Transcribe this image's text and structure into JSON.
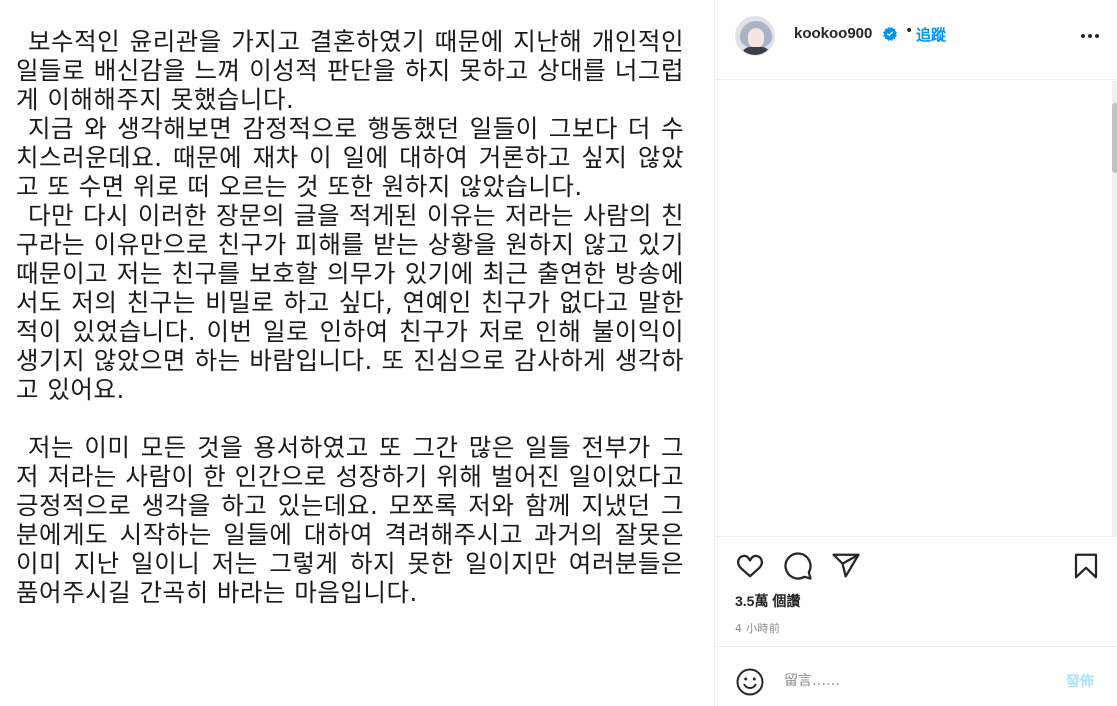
{
  "post": {
    "paragraphs": [
      "보수적인 윤리관을 가지고 결혼하였기 때문에 지난해 개인적인 일들로 배신감을 느껴 이성적 판단을 하지 못하고 상대를 너그럽게 이해해주지 못했습니다.",
      "지금 와 생각해보면 감정적으로 행동했던 일들이 그보다 더 수치스러운데요. 때문에 재차 이 일에 대하여 거론하고 싶지 않았고 또 수면 위로 떠 오르는 것 또한 원하지 않았습니다.",
      "다만 다시 이러한 장문의 글을 적게된 이유는 저라는 사람의 친구라는 이유만으로 친구가 피해를 받는 상황을 원하지 않고 있기 때문이고 저는 친구를 보호할 의무가 있기에 최근 출연한 방송에서도 저의 친구는 비밀로 하고 싶다, 연예인 친구가 없다고 말한 적이 있었습니다. 이번 일로 인하여 친구가 저로 인해 불이익이 생기지 않았으면 하는 바람입니다. 또 진심으로 감사하게 생각하고 있어요.",
      "저는 이미 모든 것을 용서하였고 또 그간 많은 일들 전부가 그저 저라는 사람이 한 인간으로 성장하기 위해 벌어진 일이었다고 긍정적으로 생각을 하고 있는데요. 모쪼록 저와 함께 지냈던 그분에게도 시작하는 일들에 대하여 격려해주시고 과거의 잘못은 이미 지난 일이니 저는 그렇게 하지 못한 일이지만 여러분들은 품어주시길 간곡히 바라는 마음입니다."
    ]
  },
  "header": {
    "username": "kookoo900",
    "separator": "•",
    "follow_label": "追蹤",
    "verified_icon": "verified-badge-icon",
    "more_icon": "more-options-icon"
  },
  "actions": {
    "views": "3.5萬 個讚",
    "time": "4 小時前"
  },
  "comment_bar": {
    "placeholder": "留言……",
    "post_label": "發佈"
  },
  "colors": {
    "accent": "#0095f6",
    "post_disabled": "#b2dffc",
    "text": "#262626",
    "muted": "#8e8e8e",
    "border": "#efefef"
  }
}
